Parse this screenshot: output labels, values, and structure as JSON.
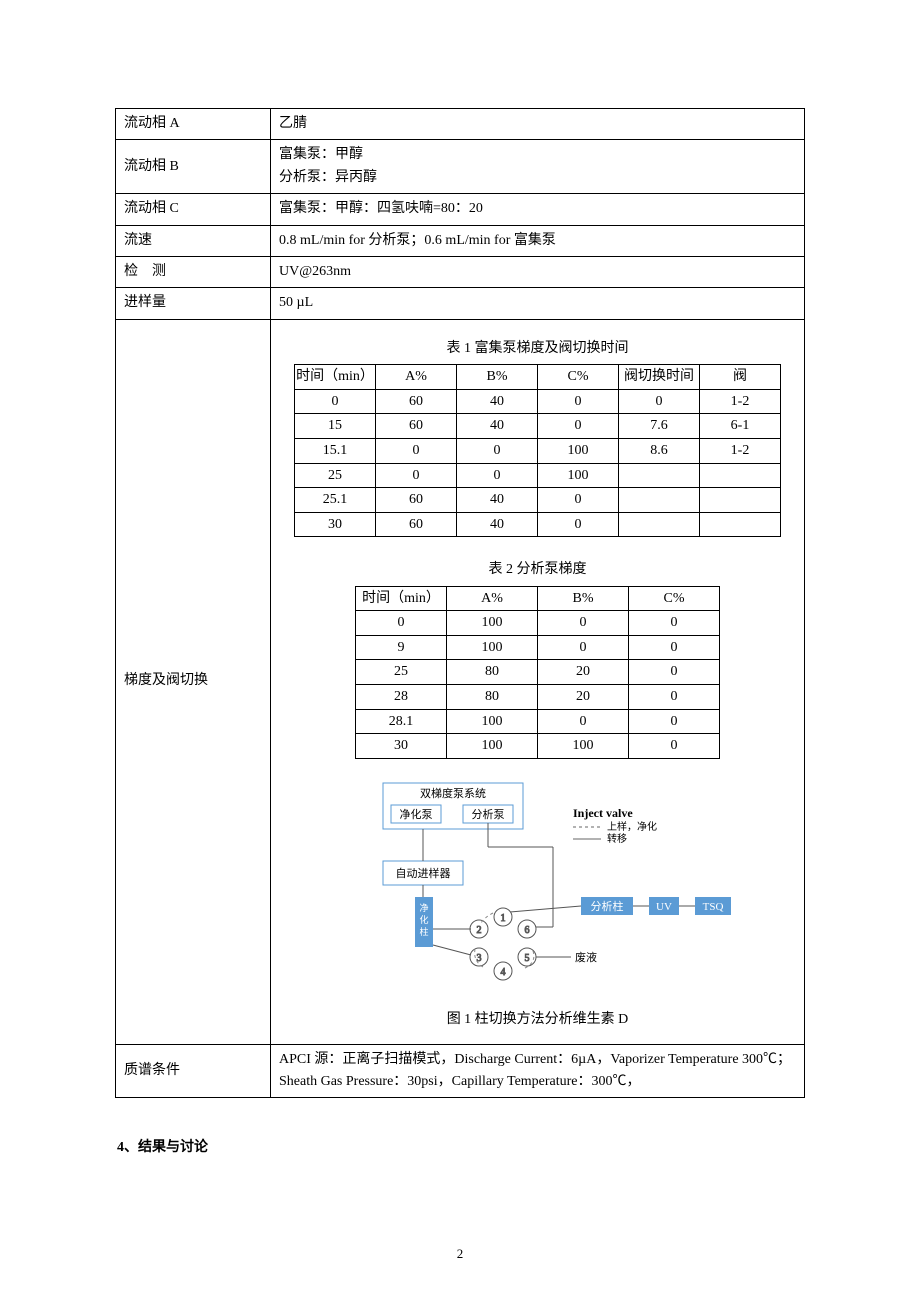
{
  "params": {
    "mobileA": {
      "label": "流动相 A",
      "value": "乙腈"
    },
    "mobileB": {
      "label": "流动相 B",
      "line1": "富集泵：甲醇",
      "line2": "分析泵：异丙醇"
    },
    "mobileC": {
      "label": "流动相 C",
      "value": "富集泵：甲醇：四氢呋喃=80：20"
    },
    "flow": {
      "label": "流速",
      "value": "0.8 mL/min for 分析泵；0.6 mL/min for 富集泵"
    },
    "detect": {
      "label": "检　测",
      "value": "UV@263nm"
    },
    "inject": {
      "label": "进样量",
      "value": "50 µL"
    },
    "gradient": {
      "label": "梯度及阀切换"
    },
    "ms": {
      "label": "质谱条件",
      "value": "APCI 源：正离子扫描模式，Discharge Current：6µA，Vaporizer Temperature 300℃；Sheath Gas Pressure：30psi，Capillary Temperature：300℃，"
    }
  },
  "table1": {
    "title": "表 1 富集泵梯度及阀切换时间",
    "headers": {
      "time": "时间（min）",
      "a": "A%",
      "b": "B%",
      "c": "C%",
      "vtime": "阀切换时间",
      "valve": "阀"
    },
    "rows": [
      {
        "t": "0",
        "a": "60",
        "b": "40",
        "c": "0",
        "vt": "0",
        "v": "1-2"
      },
      {
        "t": "15",
        "a": "60",
        "b": "40",
        "c": "0",
        "vt": "7.6",
        "v": "6-1"
      },
      {
        "t": "15.1",
        "a": "0",
        "b": "0",
        "c": "100",
        "vt": "8.6",
        "v": "1-2"
      },
      {
        "t": "25",
        "a": "0",
        "b": "0",
        "c": "100",
        "vt": "",
        "v": ""
      },
      {
        "t": "25.1",
        "a": "60",
        "b": "40",
        "c": "0",
        "vt": "",
        "v": ""
      },
      {
        "t": "30",
        "a": "60",
        "b": "40",
        "c": "0",
        "vt": "",
        "v": ""
      }
    ]
  },
  "table2": {
    "title": "表 2 分析泵梯度",
    "headers": {
      "time": "时间（min）",
      "a": "A%",
      "b": "B%",
      "c": "C%"
    },
    "rows": [
      {
        "t": "0",
        "a": "100",
        "b": "0",
        "c": "0"
      },
      {
        "t": "9",
        "a": "100",
        "b": "0",
        "c": "0"
      },
      {
        "t": "25",
        "a": "80",
        "b": "20",
        "c": "0"
      },
      {
        "t": "28",
        "a": "80",
        "b": "20",
        "c": "0"
      },
      {
        "t": "28.1",
        "a": "100",
        "b": "0",
        "c": "0"
      },
      {
        "t": "30",
        "a": "100",
        "b": "100",
        "c": "0"
      }
    ]
  },
  "figure": {
    "caption": "图 1 柱切换方法分析维生素 D",
    "labels": {
      "dualPump": "双梯度泵系统",
      "purifyPump": "净化泵",
      "analyzePump": "分析泵",
      "autosampler": "自动进样器",
      "injectValve": "Inject valve",
      "legendDash": "上样，净化",
      "legendSolid": "转移",
      "purifyCol": "净化柱",
      "analyzeCol": "分析柱",
      "uv": "UV",
      "tsq": "TSQ",
      "waste": "废液",
      "p1": "1",
      "p2": "2",
      "p3": "3",
      "p4": "4",
      "p5": "5",
      "p6": "6"
    }
  },
  "results_heading": "4、结果与讨论",
  "page_number": "2"
}
